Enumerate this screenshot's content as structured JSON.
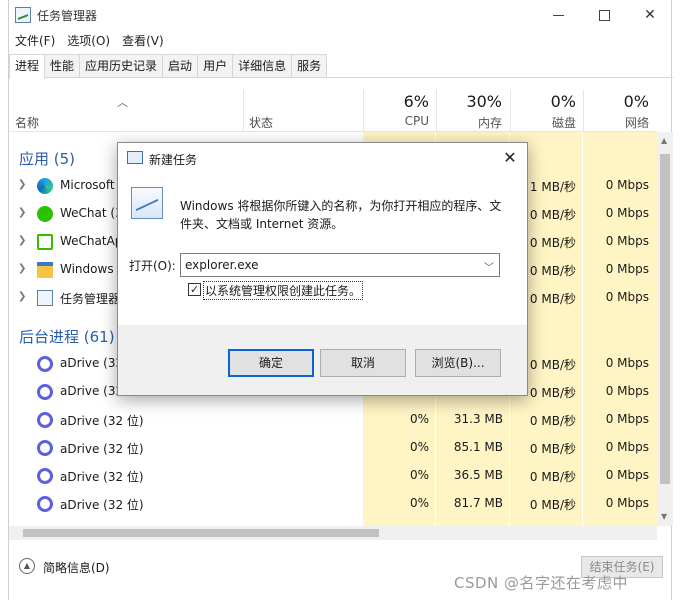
{
  "window": {
    "title": "任务管理器"
  },
  "menu": [
    "文件(F)",
    "选项(O)",
    "查看(V)"
  ],
  "tabs": [
    "进程",
    "性能",
    "应用历史记录",
    "启动",
    "用户",
    "详细信息",
    "服务"
  ],
  "active_tab": "进程",
  "header": {
    "name": "名称",
    "status": "状态",
    "cpu": {
      "pct": "6%",
      "label": "CPU"
    },
    "memory": {
      "pct": "30%",
      "label": "内存"
    },
    "disk": {
      "pct": "0%",
      "label": "磁盘"
    },
    "network": {
      "pct": "0%",
      "label": "网络"
    }
  },
  "groups": {
    "apps": "应用 (5)",
    "background": "后台进程 (61)"
  },
  "apps": [
    {
      "name": "Microsoft",
      "icon": "edge-icon",
      "disk": "1 MB/秒",
      "net": "0 Mbps"
    },
    {
      "name": "WeChat (3",
      "icon": "wechat-icon",
      "disk": "0 MB/秒",
      "net": "0 Mbps"
    },
    {
      "name": "WeChatAp",
      "icon": "wechat-app-icon",
      "disk": "0 MB/秒",
      "net": "0 Mbps"
    },
    {
      "name": "Windows",
      "icon": "folder-icon",
      "disk": "0 MB/秒",
      "net": "0 Mbps"
    },
    {
      "name": "任务管理器",
      "icon": "task-manager-icon",
      "disk": "0 MB/秒",
      "net": "0 Mbps"
    }
  ],
  "background": [
    {
      "name": "aDrive (32",
      "cpu": "",
      "mem": "",
      "disk": "0 MB/秒",
      "net": "0 Mbps"
    },
    {
      "name": "aDrive (32",
      "cpu": "",
      "mem": "",
      "disk": "0 MB/秒",
      "net": "0 Mbps"
    },
    {
      "name": "aDrive (32 位)",
      "cpu": "0%",
      "mem": "31.3 MB",
      "disk": "0 MB/秒",
      "net": "0 Mbps"
    },
    {
      "name": "aDrive (32 位)",
      "cpu": "0%",
      "mem": "85.1 MB",
      "disk": "0 MB/秒",
      "net": "0 Mbps"
    },
    {
      "name": "aDrive (32 位)",
      "cpu": "0%",
      "mem": "36.5 MB",
      "disk": "0 MB/秒",
      "net": "0 Mbps"
    },
    {
      "name": "aDrive (32 位)",
      "cpu": "0%",
      "mem": "81.7 MB",
      "disk": "0 MB/秒",
      "net": "0 Mbps"
    }
  ],
  "footer": {
    "fewer_details": "简略信息(D)",
    "end_task": "结束任务(E)"
  },
  "dialog": {
    "title": "新建任务",
    "description": "Windows 将根据你所键入的名称，为你打开相应的程序、文件夹、文档或 Internet 资源。",
    "open_label": "打开(O):",
    "open_value": "explorer.exe",
    "admin_checkbox_label": "以系统管理权限创建此任务。",
    "admin_checked": true,
    "ok": "确定",
    "cancel": "取消",
    "browse": "浏览(B)..."
  },
  "watermark": "CSDN @名字还在考虑中",
  "colors": {
    "resource_highlight": "#fff4c4",
    "group_title": "#2a5ea8",
    "default_button_border": "#0a64d6"
  }
}
